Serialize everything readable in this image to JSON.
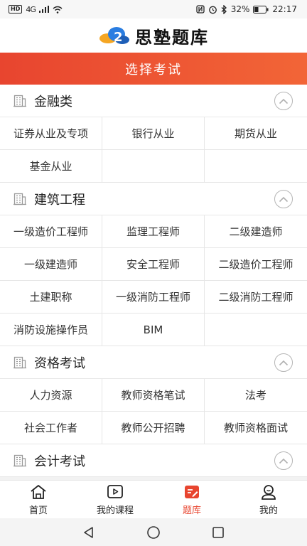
{
  "status": {
    "hd": "HD",
    "net": "4G",
    "battery_pct": "32%",
    "time": "22:17"
  },
  "header": {
    "logo_text": "思塾题库"
  },
  "banner": {
    "title": "选择考试"
  },
  "sections": [
    {
      "title": "金融类",
      "items": [
        "证券从业及专项",
        "银行从业",
        "期货从业",
        "基金从业"
      ]
    },
    {
      "title": "建筑工程",
      "items": [
        "一级造价工程师",
        "监理工程师",
        "二级建造师",
        "一级建造师",
        "安全工程师",
        "二级造价工程师",
        "土建职称",
        "一级消防工程师",
        "二级消防工程师",
        "消防设施操作员",
        "BIM"
      ]
    },
    {
      "title": "资格考试",
      "items": [
        "人力资源",
        "教师资格笔试",
        "法考",
        "社会工作者",
        "教师公开招聘",
        "教师资格面试"
      ]
    },
    {
      "title": "会计考试",
      "items": []
    }
  ],
  "tabs": [
    {
      "label": "首页",
      "icon": "home-icon"
    },
    {
      "label": "我的课程",
      "icon": "video-play-icon"
    },
    {
      "label": "题库",
      "icon": "question-bank-icon",
      "active": true
    },
    {
      "label": "我的",
      "icon": "user-icon"
    }
  ],
  "colors": {
    "accent": "#e8452f",
    "accent_light": "#f26537"
  }
}
